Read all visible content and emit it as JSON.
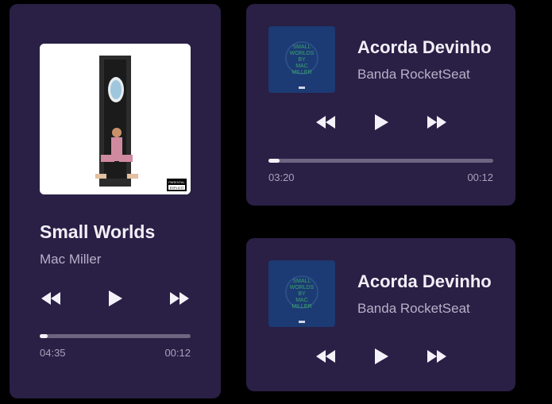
{
  "player_main": {
    "title": "Small Worlds",
    "artist": "Mac Miller",
    "time_start": "04:35",
    "time_end": "00:12",
    "progress": 0.05,
    "cover_label": "PARENTAL ADVISORY EXPLICIT CONTENT"
  },
  "player_secondary": {
    "title": "Acorda Devinho",
    "artist": "Banda RocketSeat",
    "time_start": "03:20",
    "time_end": "00:12",
    "progress": 0.05,
    "cover_text": "SMALL WORLDS BY MAC MILLER"
  },
  "player_third": {
    "title": "Acorda Devinho",
    "artist": "Banda RocketSeat",
    "cover_text": "SMALL WORLDS BY MAC MILLER"
  },
  "colors": {
    "background": "#000000",
    "card": "#2a1f45",
    "accent": "#f4f2f9",
    "muted": "#b7b1c8"
  },
  "icons": {
    "prev": "rewind-icon",
    "play": "play-icon",
    "next": "fast-forward-icon"
  }
}
